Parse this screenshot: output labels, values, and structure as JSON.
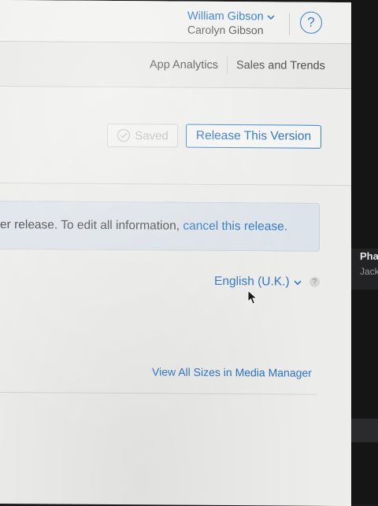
{
  "header": {
    "user_name": "William Gibson",
    "user_sub": "Carolyn Gibson",
    "help_label": "?"
  },
  "subnav": {
    "items": [
      {
        "label": "App Analytics"
      },
      {
        "label": "Sales and Trends"
      }
    ]
  },
  "toolbar": {
    "saved_label": "Saved",
    "release_label": "Release This Version"
  },
  "banner": {
    "text": "er release. To edit all information, ",
    "link": "cancel this release."
  },
  "localization": {
    "language": "English (U.K.)",
    "help": "?"
  },
  "media": {
    "link": "View All Sizes in Media Manager"
  },
  "background_window": {
    "title": "Pha",
    "subtitle": "Jack"
  },
  "colors": {
    "accent": "#2b73c5",
    "page_bg": "#ececea",
    "banner_bg": "#dde3ea"
  }
}
